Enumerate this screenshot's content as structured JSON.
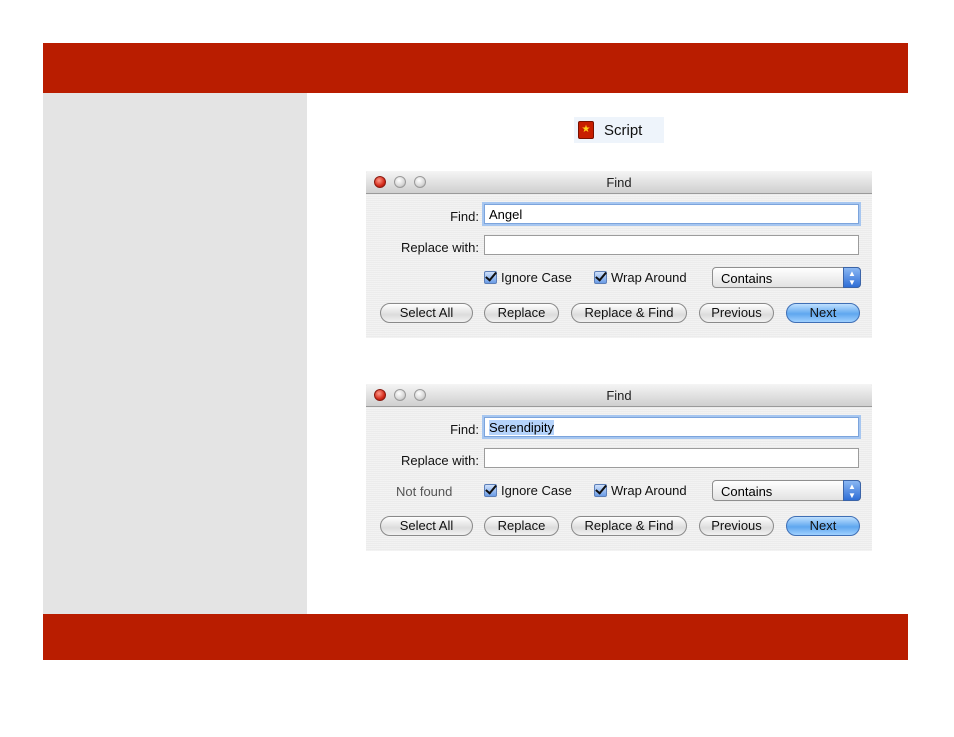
{
  "script_label": "Script",
  "icons": {
    "script_icon": "star-icon",
    "close": "close-button-icon",
    "minimize": "minimize-button-icon",
    "zoom": "zoom-button-icon",
    "popup_arrows": "updown-arrows-icon",
    "checkbox": "checkmark-icon"
  },
  "colors": {
    "band": "#b91d00",
    "sidebar": "#e4e4e4",
    "default_button": "#5fa7ef",
    "selection": "#b5d3fb"
  },
  "window1": {
    "title": "Find",
    "find_label": "Find:",
    "find_value": "Angel",
    "replace_label": "Replace with:",
    "replace_value": "",
    "status": "",
    "ignore_case": "Ignore Case",
    "wrap_around": "Wrap Around",
    "match_mode": "Contains",
    "buttons": {
      "select_all": "Select All",
      "replace": "Replace",
      "replace_find": "Replace & Find",
      "previous": "Previous",
      "next": "Next"
    }
  },
  "window2": {
    "title": "Find",
    "find_label": "Find:",
    "find_value": "Serendipity",
    "replace_label": "Replace with:",
    "replace_value": "",
    "status": "Not found",
    "ignore_case": "Ignore Case",
    "wrap_around": "Wrap Around",
    "match_mode": "Contains",
    "buttons": {
      "select_all": "Select All",
      "replace": "Replace",
      "replace_find": "Replace & Find",
      "previous": "Previous",
      "next": "Next"
    }
  }
}
